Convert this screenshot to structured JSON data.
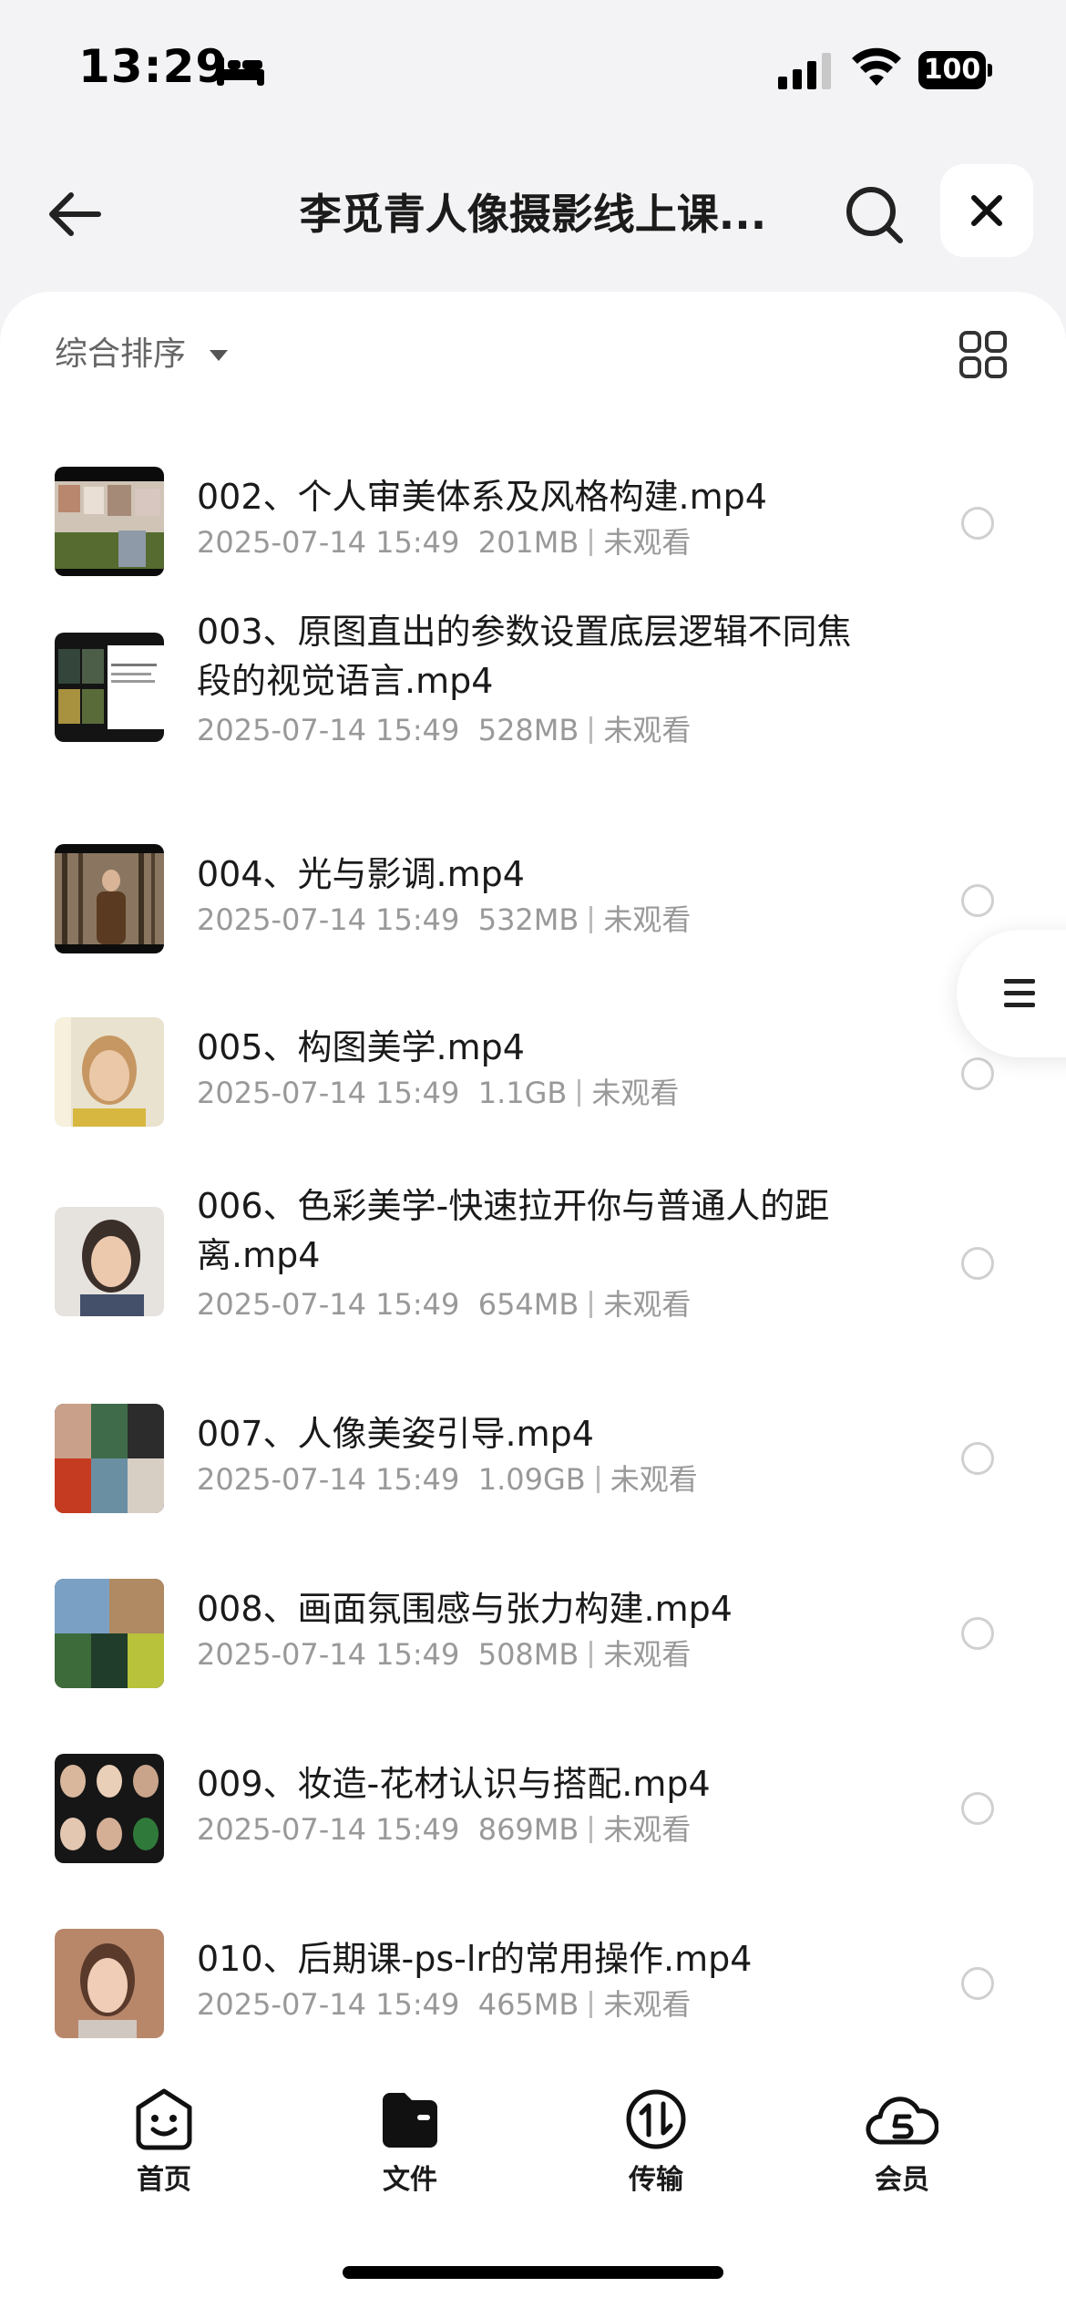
{
  "status_bar": {
    "time": "13:29",
    "battery": "100"
  },
  "header": {
    "title": "李觅青人像摄影线上课..."
  },
  "toolbar": {
    "sort_label": "综合排序"
  },
  "files": [
    {
      "name": "002、个人审美体系及风格构建.mp4",
      "date": "2025-07-14 15:49",
      "size": "201MB",
      "status": "未观看"
    },
    {
      "name": "003、原图直出的参数设置底层逻辑不同焦段的视觉语言.mp4",
      "date": "2025-07-14 15:49",
      "size": "528MB",
      "status": "未观看"
    },
    {
      "name": "004、光与影调.mp4",
      "date": "2025-07-14 15:49",
      "size": "532MB",
      "status": "未观看"
    },
    {
      "name": "005、构图美学.mp4",
      "date": "2025-07-14 15:49",
      "size": "1.1GB",
      "status": "未观看"
    },
    {
      "name": "006、色彩美学-快速拉开你与普通人的距离.mp4",
      "date": "2025-07-14 15:49",
      "size": "654MB",
      "status": "未观看"
    },
    {
      "name": "007、人像美姿引导.mp4",
      "date": "2025-07-14 15:49",
      "size": "1.09GB",
      "status": "未观看"
    },
    {
      "name": "008、画面氛围感与张力构建.mp4",
      "date": "2025-07-14 15:49",
      "size": "508MB",
      "status": "未观看"
    },
    {
      "name": "009、妆造-花材认识与搭配.mp4",
      "date": "2025-07-14 15:49",
      "size": "869MB",
      "status": "未观看"
    },
    {
      "name": "010、后期课-ps-lr的常用操作.mp4",
      "date": "2025-07-14 15:49",
      "size": "465MB",
      "status": "未观看"
    }
  ],
  "tabs": [
    {
      "label": "首页",
      "icon": "smile-icon"
    },
    {
      "label": "文件",
      "icon": "folder-icon"
    },
    {
      "label": "传输",
      "icon": "transfer-icon"
    },
    {
      "label": "会员",
      "icon": "cloud-s-icon"
    }
  ]
}
